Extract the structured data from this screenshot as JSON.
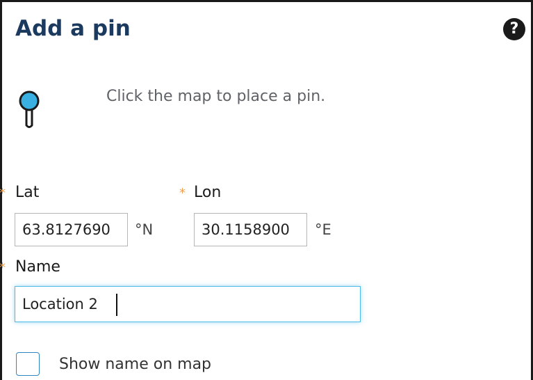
{
  "dialog": {
    "title": "Add a pin",
    "help_icon": "question-circle-icon",
    "help_glyph": "?",
    "pin_icon": "map-pin-icon",
    "hint": "Click the map to place a pin."
  },
  "form": {
    "required_marker": "*",
    "lat": {
      "label": "Lat",
      "value": "63.8127690",
      "unit": "°N"
    },
    "lon": {
      "label": "Lon",
      "value": "30.1158900",
      "unit": "°E"
    },
    "name": {
      "label": "Name",
      "value": "Location 2"
    },
    "show_name_on_map": {
      "label": "Show name on map",
      "checked": false
    }
  },
  "colors": {
    "title": "#1c3a5e",
    "required_marker": "#f0a04a",
    "pin_fill": "#3ab0e2",
    "focus_border": "#4cb9e6",
    "checkbox_border": "#2e86c1"
  }
}
